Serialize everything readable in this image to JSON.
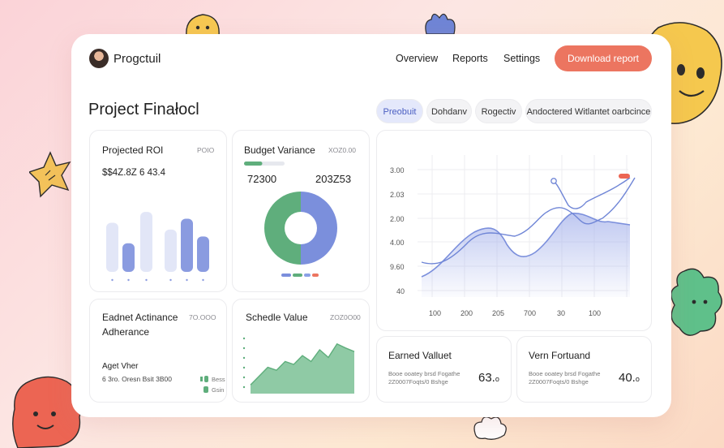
{
  "app": {
    "name": "Progctuil"
  },
  "nav": [
    "Overview",
    "Reports",
    "Settings"
  ],
  "actions": {
    "download": "Download report"
  },
  "page_title": "Project Finałocl",
  "filters": [
    {
      "label": "Preobuit",
      "active": true
    },
    {
      "label": "Dohdanv",
      "active": false
    },
    {
      "label": "Rogectiv",
      "active": false
    },
    {
      "label": "Andoctered Witlantet oarbcince",
      "active": false
    }
  ],
  "roi": {
    "title": "Projected ROI",
    "tag": "POIO",
    "value": "$$4Z.8Z 6 43.4",
    "bars": [
      0.72,
      0.42,
      0.88,
      0.62,
      0.78,
      0.52
    ]
  },
  "budget": {
    "title": "Budget Variance",
    "tag": "XOZ0.00",
    "left_value": "72300",
    "right_value": "203Z53",
    "donut_share": 0.5,
    "progress": 0.45
  },
  "adherence": {
    "title_line1": "Eadnet Actinance",
    "title_line2": "Adherance",
    "tag": "7O.OOO",
    "sub_title": "Aget Vher",
    "sub_value": "6 3ro.  Oresn Bsit 3B00",
    "legend": [
      "Bess",
      "Gsin"
    ]
  },
  "schedule": {
    "title": "Schedle Value",
    "tag": "ZOZ0O00",
    "area_values": [
      0.15,
      0.3,
      0.45,
      0.4,
      0.55,
      0.5,
      0.65,
      0.55,
      0.75,
      0.62,
      0.85,
      0.78,
      0.72
    ]
  },
  "line_chart": {
    "y_labels": [
      "3.00",
      "2.03",
      "2.00",
      "4.00",
      "9.60",
      "40"
    ],
    "x_labels": [
      "100",
      "200",
      "205",
      "700",
      "30",
      "100"
    ]
  },
  "earned": {
    "title": "Earned Valluet",
    "desc": "Booe ooatey brsd Fogathe 2Z0007Foqts/0 Bshge",
    "value": "63.",
    "marker": "o"
  },
  "forecast": {
    "title": "Vern Fortuand",
    "desc": "Booe ooatey brsd Fogathe 2Z0007Foqts/0 Bshge",
    "value": "40.",
    "marker": "o"
  },
  "colors": {
    "accent": "#ec7560",
    "blue": "#7b8fdc",
    "green": "#5fae7c",
    "light_blue": "#c9d1f3"
  }
}
